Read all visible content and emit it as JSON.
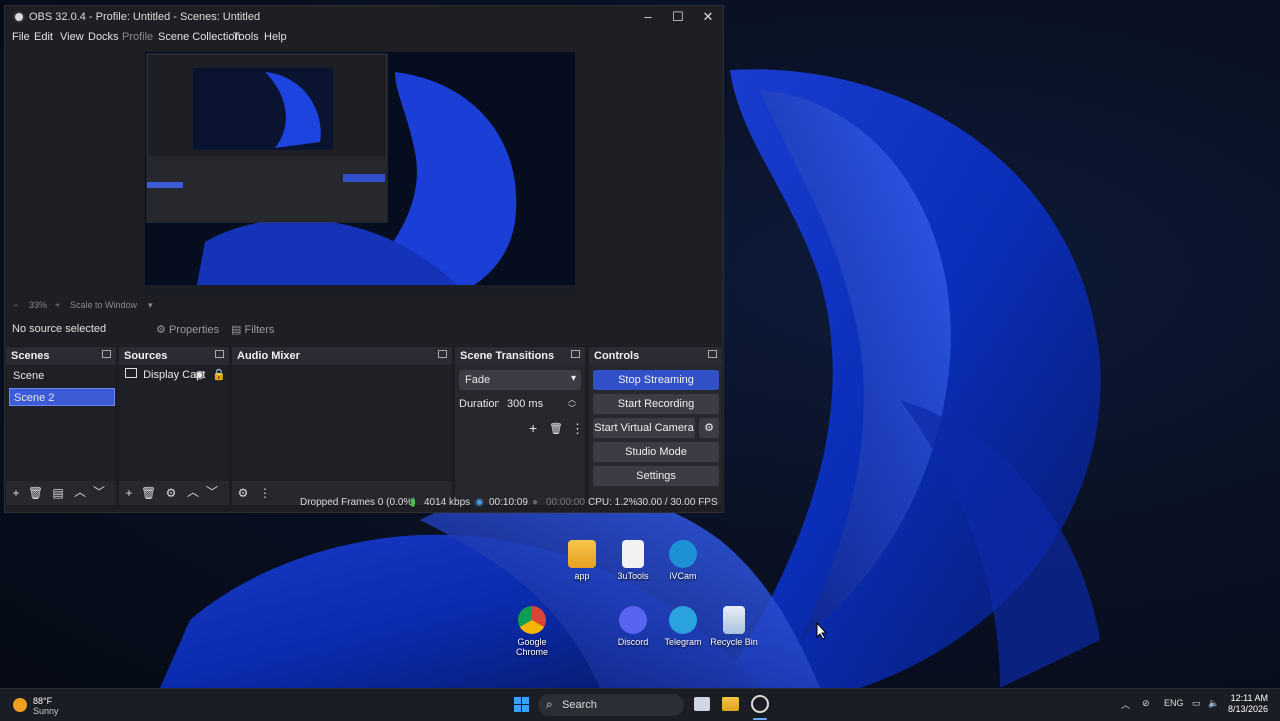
{
  "window": {
    "title": "OBS 32.0.4 - Profile: Untitled - Scenes: Untitled",
    "minimize": "–",
    "maximize": "☐",
    "close": "✕"
  },
  "menu": [
    "File",
    "Edit",
    "View",
    "Docks",
    "Profile",
    "Scene Collection",
    "Tools",
    "Help"
  ],
  "preview": {
    "zoom_minus": "−",
    "zoom": "33%",
    "zoom_plus": "+",
    "scale_mode": "Scale to Window"
  },
  "source_bar": {
    "no_source": "No source selected",
    "properties": "Properties",
    "filters": "Filters"
  },
  "scenes": {
    "header": "Scenes",
    "items": [
      "Scene",
      "Scene 2"
    ],
    "selected": "Scene 2"
  },
  "sources": {
    "header": "Sources",
    "items": [
      {
        "name": "Display Capt",
        "icon": "monitor-icon"
      }
    ]
  },
  "audio_mixer": {
    "header": "Audio Mixer"
  },
  "transitions": {
    "header": "Scene Transitions",
    "transition": "Fade",
    "duration_label": "Duration",
    "duration_value": "300 ms"
  },
  "controls": {
    "header": "Controls",
    "stop_streaming": "Stop Streaming",
    "start_recording": "Start Recording",
    "start_virtual_camera": "Start Virtual Camera",
    "studio_mode": "Studio Mode",
    "settings": "Settings",
    "accent": "#3250c8"
  },
  "status": {
    "dropped_frames": "Dropped Frames 0 (0.0%)",
    "bitrate": "4014 kbps",
    "stream_time": "00:10:09",
    "record_time": "00:00:00",
    "cpu": "CPU: 1.2%",
    "fps": "30.00 / 30.00 FPS"
  },
  "desktop_icons": [
    {
      "label": "app",
      "icon": "folder-icon"
    },
    {
      "label": "3uTools",
      "icon": "file-icon"
    },
    {
      "label": "iVCam",
      "icon": "camera-icon"
    },
    {
      "label": "Google Chrome",
      "icon": "chrome-icon"
    },
    {
      "label": "Discord",
      "icon": "discord-icon"
    },
    {
      "label": "Telegram",
      "icon": "telegram-icon"
    },
    {
      "label": "Recycle Bin",
      "icon": "recycle-bin-icon"
    }
  ],
  "taskbar": {
    "temperature": "88°F",
    "condition": "Sunny",
    "search": "Search",
    "language": "ENG",
    "time": "12:11 AM",
    "date": "8/13/2026"
  }
}
